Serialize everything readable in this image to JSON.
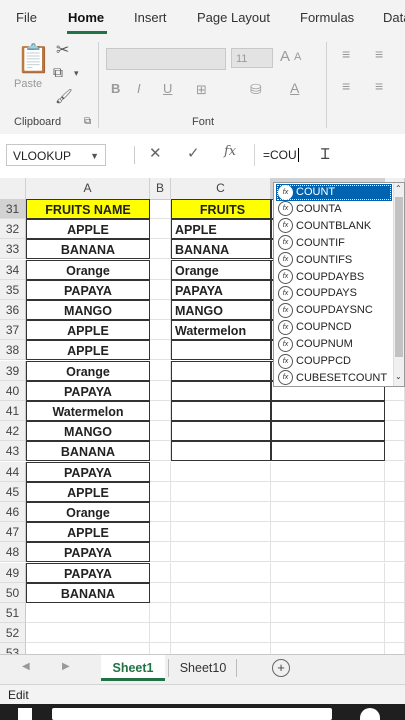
{
  "ribbon": {
    "tabs": [
      "File",
      "Home",
      "Insert",
      "Page Layout",
      "Formulas",
      "Data"
    ],
    "active_tab": "Home",
    "paste_label": "Paste",
    "clipboard_label": "Clipboard",
    "font_label": "Font",
    "font_size": "11",
    "bold": "B",
    "italic": "I",
    "underline": "U"
  },
  "formula_bar": {
    "name_box": "VLOOKUP",
    "formula": "=COU",
    "fx": "fx"
  },
  "columns": [
    "A",
    "B",
    "C"
  ],
  "rows": [
    {
      "num": "31",
      "a": "FRUITS NAME",
      "c": "FRUITS"
    },
    {
      "num": "32",
      "a": "APPLE",
      "c": "APPLE"
    },
    {
      "num": "33",
      "a": "BANANA",
      "c": "BANANA"
    },
    {
      "num": "34",
      "a": "Orange",
      "c": "Orange"
    },
    {
      "num": "35",
      "a": "PAPAYA",
      "c": "PAPAYA"
    },
    {
      "num": "36",
      "a": "MANGO",
      "c": "MANGO"
    },
    {
      "num": "37",
      "a": "APPLE",
      "c": "Watermelon"
    },
    {
      "num": "38",
      "a": "APPLE",
      "c": ""
    },
    {
      "num": "39",
      "a": "Orange",
      "c": ""
    },
    {
      "num": "40",
      "a": "PAPAYA",
      "c": ""
    },
    {
      "num": "41",
      "a": "Watermelon",
      "c": ""
    },
    {
      "num": "42",
      "a": "MANGO",
      "c": ""
    },
    {
      "num": "43",
      "a": "BANANA",
      "c": ""
    },
    {
      "num": "44",
      "a": "PAPAYA",
      "c": ""
    },
    {
      "num": "45",
      "a": "APPLE",
      "c": ""
    },
    {
      "num": "46",
      "a": "Orange",
      "c": ""
    },
    {
      "num": "47",
      "a": "APPLE",
      "c": ""
    },
    {
      "num": "48",
      "a": "PAPAYA",
      "c": ""
    },
    {
      "num": "49",
      "a": "PAPAYA",
      "c": ""
    },
    {
      "num": "50",
      "a": "BANANA",
      "c": ""
    },
    {
      "num": "51",
      "a": "",
      "c": ""
    },
    {
      "num": "52",
      "a": "",
      "c": ""
    },
    {
      "num": "53",
      "a": "",
      "c": ""
    }
  ],
  "autocomplete": [
    "COUNT",
    "COUNTA",
    "COUNTBLANK",
    "COUNTIF",
    "COUNTIFS",
    "COUPDAYBS",
    "COUPDAYS",
    "COUPDAYSNC",
    "COUPNCD",
    "COUPNUM",
    "COUPPCD",
    "CUBESETCOUNT"
  ],
  "sheets": {
    "active": "Sheet1",
    "other": "Sheet10",
    "add": "+"
  },
  "status": "Edit",
  "colors": {
    "accent": "#217346",
    "header_fill": "#ffff00",
    "selection": "#0063b1"
  }
}
